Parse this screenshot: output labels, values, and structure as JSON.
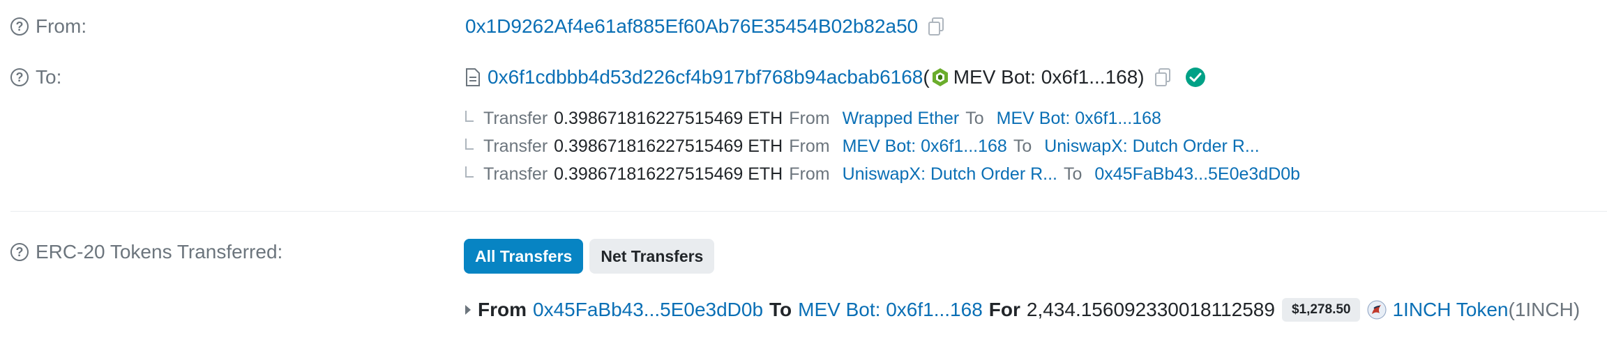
{
  "from": {
    "label": "From:",
    "address": "0x1D9262Af4e61af885Ef60Ab76E35454B02b82a50"
  },
  "to": {
    "label": "To:",
    "address": "0x6f1cdbbb4d53d226cf4b917bf768b94acbab6168",
    "open_paren": "(",
    "name": "MEV Bot: 0x6f1...168",
    "close_paren": ")"
  },
  "internal_transfers": [
    {
      "word": "Transfer",
      "amount": "0.398671816227515469 ETH",
      "from_word": "From",
      "from": "Wrapped Ether",
      "to_word": "To",
      "to": "MEV Bot: 0x6f1...168"
    },
    {
      "word": "Transfer",
      "amount": "0.398671816227515469 ETH",
      "from_word": "From",
      "from": "MEV Bot: 0x6f1...168",
      "to_word": "To",
      "to": "UniswapX: Dutch Order R..."
    },
    {
      "word": "Transfer",
      "amount": "0.398671816227515469 ETH",
      "from_word": "From",
      "from": "UniswapX: Dutch Order R...",
      "to_word": "To",
      "to": "0x45FaBb43...5E0e3dD0b"
    }
  ],
  "erc20": {
    "label": "ERC-20 Tokens Transferred:",
    "tabs": [
      {
        "label": "All Transfers",
        "active": true
      },
      {
        "label": "Net Transfers",
        "active": false
      }
    ],
    "transfer": {
      "from_word": "From",
      "from": "0x45FaBb43...5E0e3dD0b",
      "to_word": "To",
      "to": "MEV Bot: 0x6f1...168",
      "for_word": "For",
      "amount": "2,434.156092330018112589",
      "usd": "$1,278.50",
      "token_name": "1INCH Token",
      "token_symbol": "(1INCH)"
    }
  },
  "colors": {
    "link": "#0a6fb5",
    "accent": "#0784c3",
    "success": "#00a186",
    "muted": "#6c757d"
  },
  "icons": [
    "question-icon",
    "copy-icon",
    "contract-icon",
    "mev-bot-icon",
    "verified-check-icon",
    "caret-right-icon",
    "token-1inch-icon"
  ]
}
